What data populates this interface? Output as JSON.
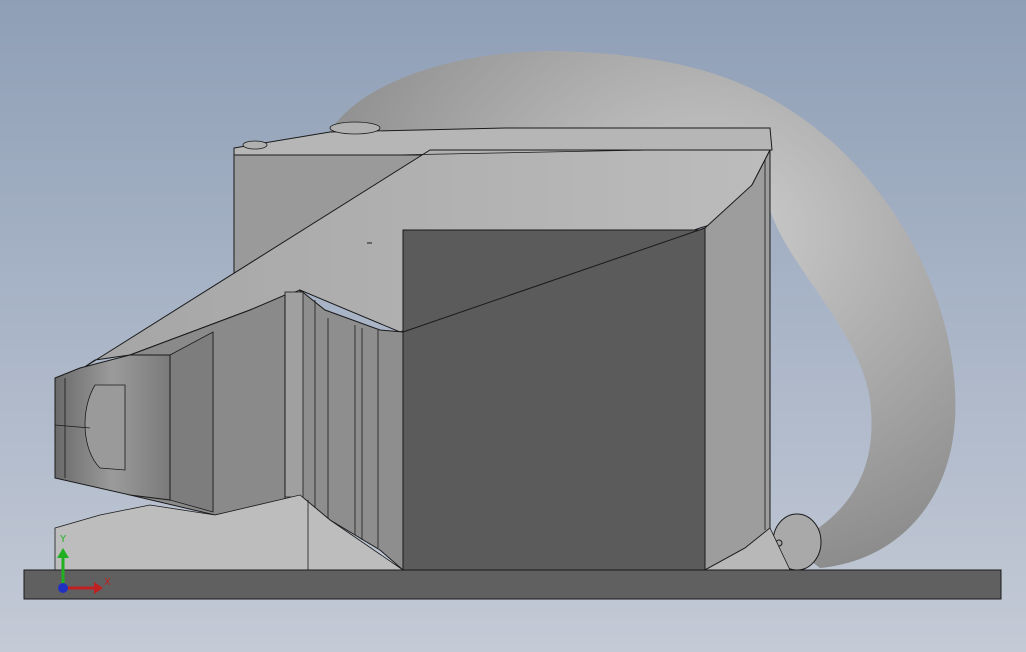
{
  "view": {
    "background_top": "#8f9fb6",
    "background_bottom": "#c4cad6"
  },
  "model": {
    "base_color": "#606060",
    "dark_face_color": "#5b5b5b",
    "light_face_color": "#b3b3b3",
    "hose_color": "#a6a6a6",
    "edge_color": "#1a1a1a"
  },
  "triad": {
    "x_label": "X",
    "y_label": "Y",
    "x_color": "#c02020",
    "y_color": "#20b020",
    "z_color": "#2030c0"
  }
}
